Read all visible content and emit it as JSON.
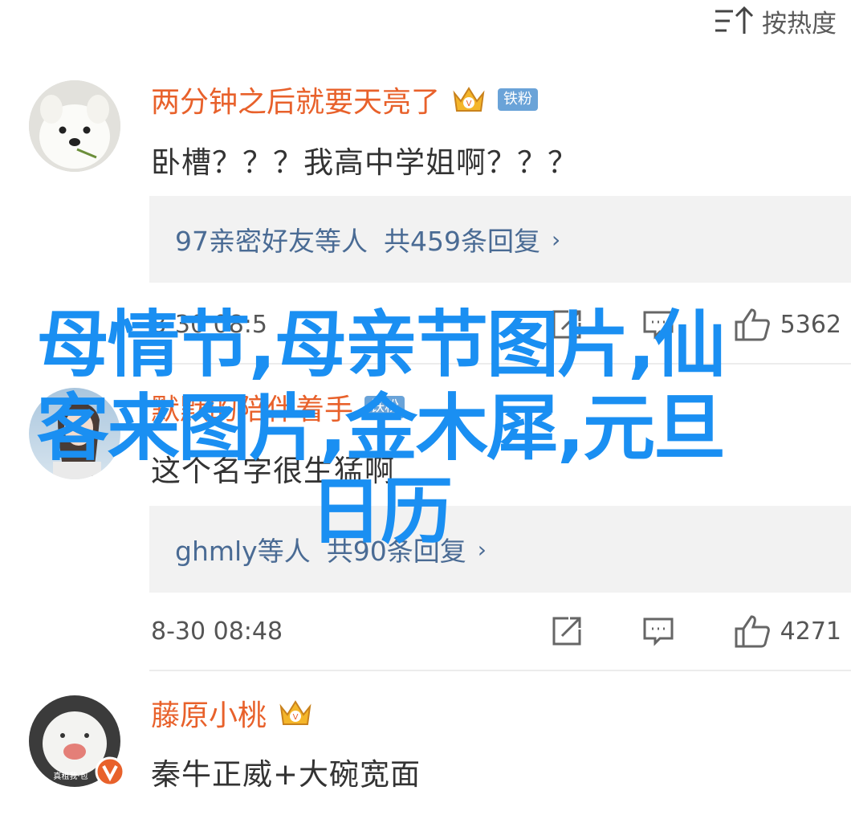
{
  "sort": {
    "label": "按热度",
    "icon": "sort-icon"
  },
  "comments": [
    {
      "username": "两分钟之后就要天亮了",
      "badge": "铁粉",
      "text": "卧槽？？？我高中学姐啊？？？",
      "reply_summary": {
        "names": "97亲密好友等人",
        "count": "共459条回复"
      },
      "time": "8-30 08:5",
      "likes": "5362"
    },
    {
      "username": "默默的陪伴着手",
      "badge": "铁粉",
      "text": "这个名字很生猛啊",
      "reply_summary": {
        "names": "ghmly等人",
        "count": "共90条回复"
      },
      "time": "8-30 08:48",
      "likes": "4271"
    },
    {
      "username": "藤原小桃",
      "text": "秦牛正威+大碗宽面",
      "avatar_caption": "真租我·包"
    }
  ],
  "overlay_headline": "母情节,母亲节图片,仙客来图片,金木犀,元旦日历",
  "colors": {
    "username": "#e8612b",
    "link": "#4a6b94",
    "overlay": "#1a8ff2",
    "badge": "#6aa3d8",
    "verified": "#e8612b"
  }
}
